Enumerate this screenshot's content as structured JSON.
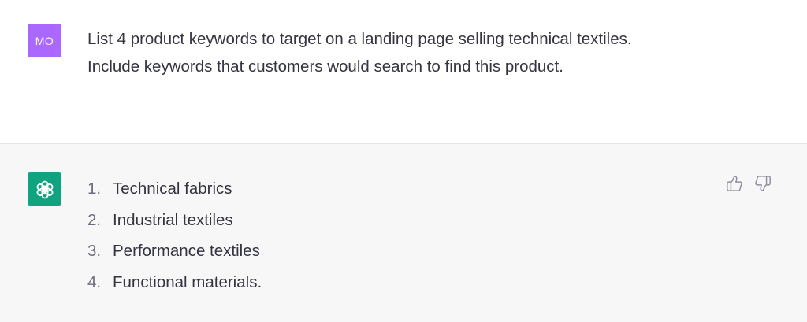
{
  "user_message": {
    "avatar_initials": "MO",
    "avatar_color": "#ab68ff",
    "lines": [
      "List 4 product keywords to target on a landing page selling technical textiles.",
      "Include keywords that customers would search to find this product."
    ]
  },
  "assistant_message": {
    "avatar_icon": "openai-logo-icon",
    "avatar_color": "#10a37f",
    "items": [
      {
        "number": "1.",
        "text": "Technical fabrics"
      },
      {
        "number": "2.",
        "text": "Industrial textiles"
      },
      {
        "number": "3.",
        "text": "Performance textiles"
      },
      {
        "number": "4.",
        "text": "Functional materials."
      }
    ],
    "feedback_icons": [
      "thumbs-up-icon",
      "thumbs-down-icon"
    ]
  }
}
